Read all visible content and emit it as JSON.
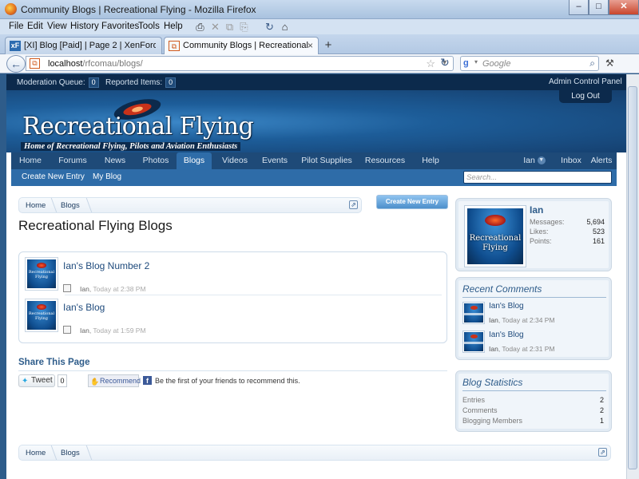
{
  "window": {
    "title": "Community Blogs | Recreational Flying - Mozilla Firefox",
    "buttons": {
      "minimize": "–",
      "maximize": "□",
      "close": "✕"
    }
  },
  "menu": {
    "items": [
      "File",
      "Edit",
      "View",
      "History",
      "Favorites",
      "Tools",
      "Help"
    ],
    "toolbar_icons": [
      "print-icon",
      "cut-icon",
      "copy-icon",
      "paste-icon",
      "reload-icon",
      "home-icon"
    ]
  },
  "tabs": [
    {
      "icon": "xF",
      "label": "[XI] Blog [Paid] | Page 2 | XenForo Co...",
      "active": false
    },
    {
      "icon": "⧉",
      "label": "Community Blogs | Recreational Flying",
      "active": true
    }
  ],
  "tab_close": "×",
  "tab_new": "+",
  "navbar": {
    "back": "←",
    "url_host": "localhost",
    "url_path": "/rfcomau/blogs/",
    "search_placeholder": "Google",
    "star": "☆",
    "dropdown": "▼",
    "reload": "↻",
    "magnifier": "⌕",
    "ext": "⚒"
  },
  "adminbar": {
    "moderation_label": "Moderation Queue:",
    "moderation_count": "0",
    "reported_label": "Reported Items:",
    "reported_count": "0",
    "acp": "Admin Control Panel"
  },
  "header": {
    "logout": "Log Out",
    "logo_title": "Recreational Flying",
    "logo_subtitle": "Home of Recreational Flying, Pilots and Aviation Enthusiasts"
  },
  "nav": {
    "items": [
      "Home",
      "Forums",
      "News",
      "Photos",
      "Blogs",
      "Videos",
      "Events",
      "Pilot Supplies",
      "Resources",
      "Help"
    ],
    "active": "Blogs",
    "user": "Ian",
    "inbox": "Inbox",
    "alerts": "Alerts"
  },
  "subnav": {
    "create": "Create New Entry",
    "my_blog": "My Blog",
    "search_placeholder": "Search..."
  },
  "breadcrumb": {
    "items": [
      "Home",
      "Blogs"
    ],
    "ext": "⇗"
  },
  "create_button": "Create New Entry",
  "page_title": "Recreational Flying Blogs",
  "blogs": [
    {
      "title": "Ian's Blog Number 2",
      "author": "Ian",
      "time": "Today at 2:38 PM",
      "thumb_text": "Recreational Flying"
    },
    {
      "title": "Ian's Blog",
      "author": "Ian",
      "time": "Today at 1:59 PM",
      "thumb_text": "Recreational Flying"
    }
  ],
  "share": {
    "title": "Share This Page",
    "tweet": "Tweet",
    "tweet_count": "0",
    "recommend": "Recommend",
    "fb_text": "Be the first of your friends to recommend this."
  },
  "visitor": {
    "name": "Ian",
    "avatar_text": "Recreational Flying",
    "stats": [
      {
        "label": "Messages:",
        "value": "5,694"
      },
      {
        "label": "Likes:",
        "value": "523"
      },
      {
        "label": "Points:",
        "value": "161"
      }
    ]
  },
  "recent_comments": {
    "title": "Recent Comments",
    "items": [
      {
        "title": "Ian's Blog",
        "author": "Ian",
        "time": "Today at 2:34 PM"
      },
      {
        "title": "Ian's Blog",
        "author": "Ian",
        "time": "Today at 2:31 PM"
      }
    ]
  },
  "blog_stats": {
    "title": "Blog Statistics",
    "items": [
      {
        "label": "Entries",
        "value": "2"
      },
      {
        "label": "Comments",
        "value": "2"
      },
      {
        "label": "Blogging Members",
        "value": "1"
      }
    ]
  },
  "colors": {
    "accent": "#2e6ca8",
    "header_dark": "#0c2a4c",
    "link": "#1e4a7c"
  }
}
